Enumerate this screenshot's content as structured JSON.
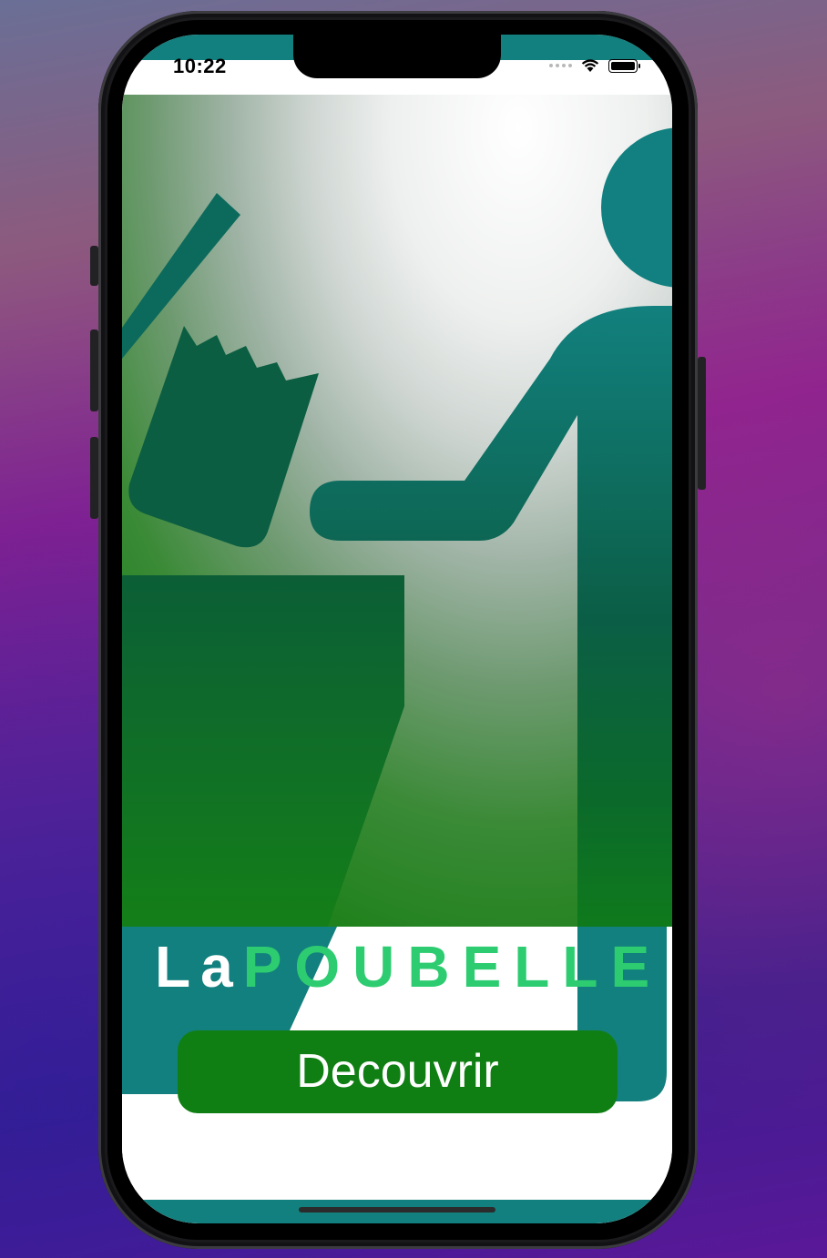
{
  "status_bar": {
    "time": "10:22"
  },
  "app": {
    "logo_prefix": "La",
    "logo_main": "POUBELLE",
    "discover_button": "Decouvrir"
  },
  "colors": {
    "brand_teal": "#12807e",
    "dark_green": "#0a5e3c",
    "button_green": "#107f13",
    "logo_green": "#2ecc71"
  },
  "icons": {
    "hero": "person-throwing-trash-illustration",
    "wifi": "wifi-icon",
    "battery": "battery-icon",
    "signal": "cellular-signal-icon"
  }
}
